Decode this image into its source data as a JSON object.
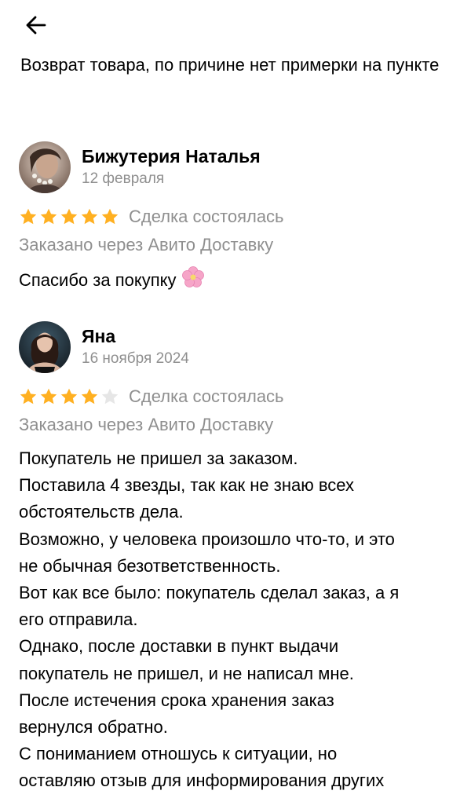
{
  "header": {
    "back_icon": "arrow-left-icon"
  },
  "intro": "Возврат товара, по причине нет примерки на пункте",
  "reviews": [
    {
      "author": "Бижутерия Наталья",
      "date": "12 февраля",
      "rating": 5,
      "rating_max": 5,
      "deal_status": "Сделка состоялась",
      "delivery": "Заказано через Авито Доставку",
      "text": "Спасибо за покупку",
      "emoji": "cherry-blossom-icon"
    },
    {
      "author": "Яна",
      "date": "16 ноября 2024",
      "rating": 4,
      "rating_max": 5,
      "deal_status": "Сделка состоялась",
      "delivery": "Заказано через Авито Доставку",
      "lines": [
        "Покупатель не пришел за заказом.",
        "Поставила 4 звезды, так как не знаю всех",
        "обстоятельств дела.",
        "Возможно, у человека произошло что-то, и это",
        "не обычная безответственность.",
        "Вот как все было:  покупатель сделал заказ, а я",
        "его отправила.",
        "Однако, после доставки в пункт выдачи",
        "покупатель не пришел, и  не написал мне.",
        "После истечения срока хранения заказ",
        "вернулся обратно.",
        "С пониманием отношусь к ситуации, но",
        "оставляю отзыв для информирования других"
      ]
    }
  ],
  "colors": {
    "star_filled": "#FFB021",
    "star_empty": "#E6E6E6",
    "muted_text": "#8F8F8F"
  }
}
